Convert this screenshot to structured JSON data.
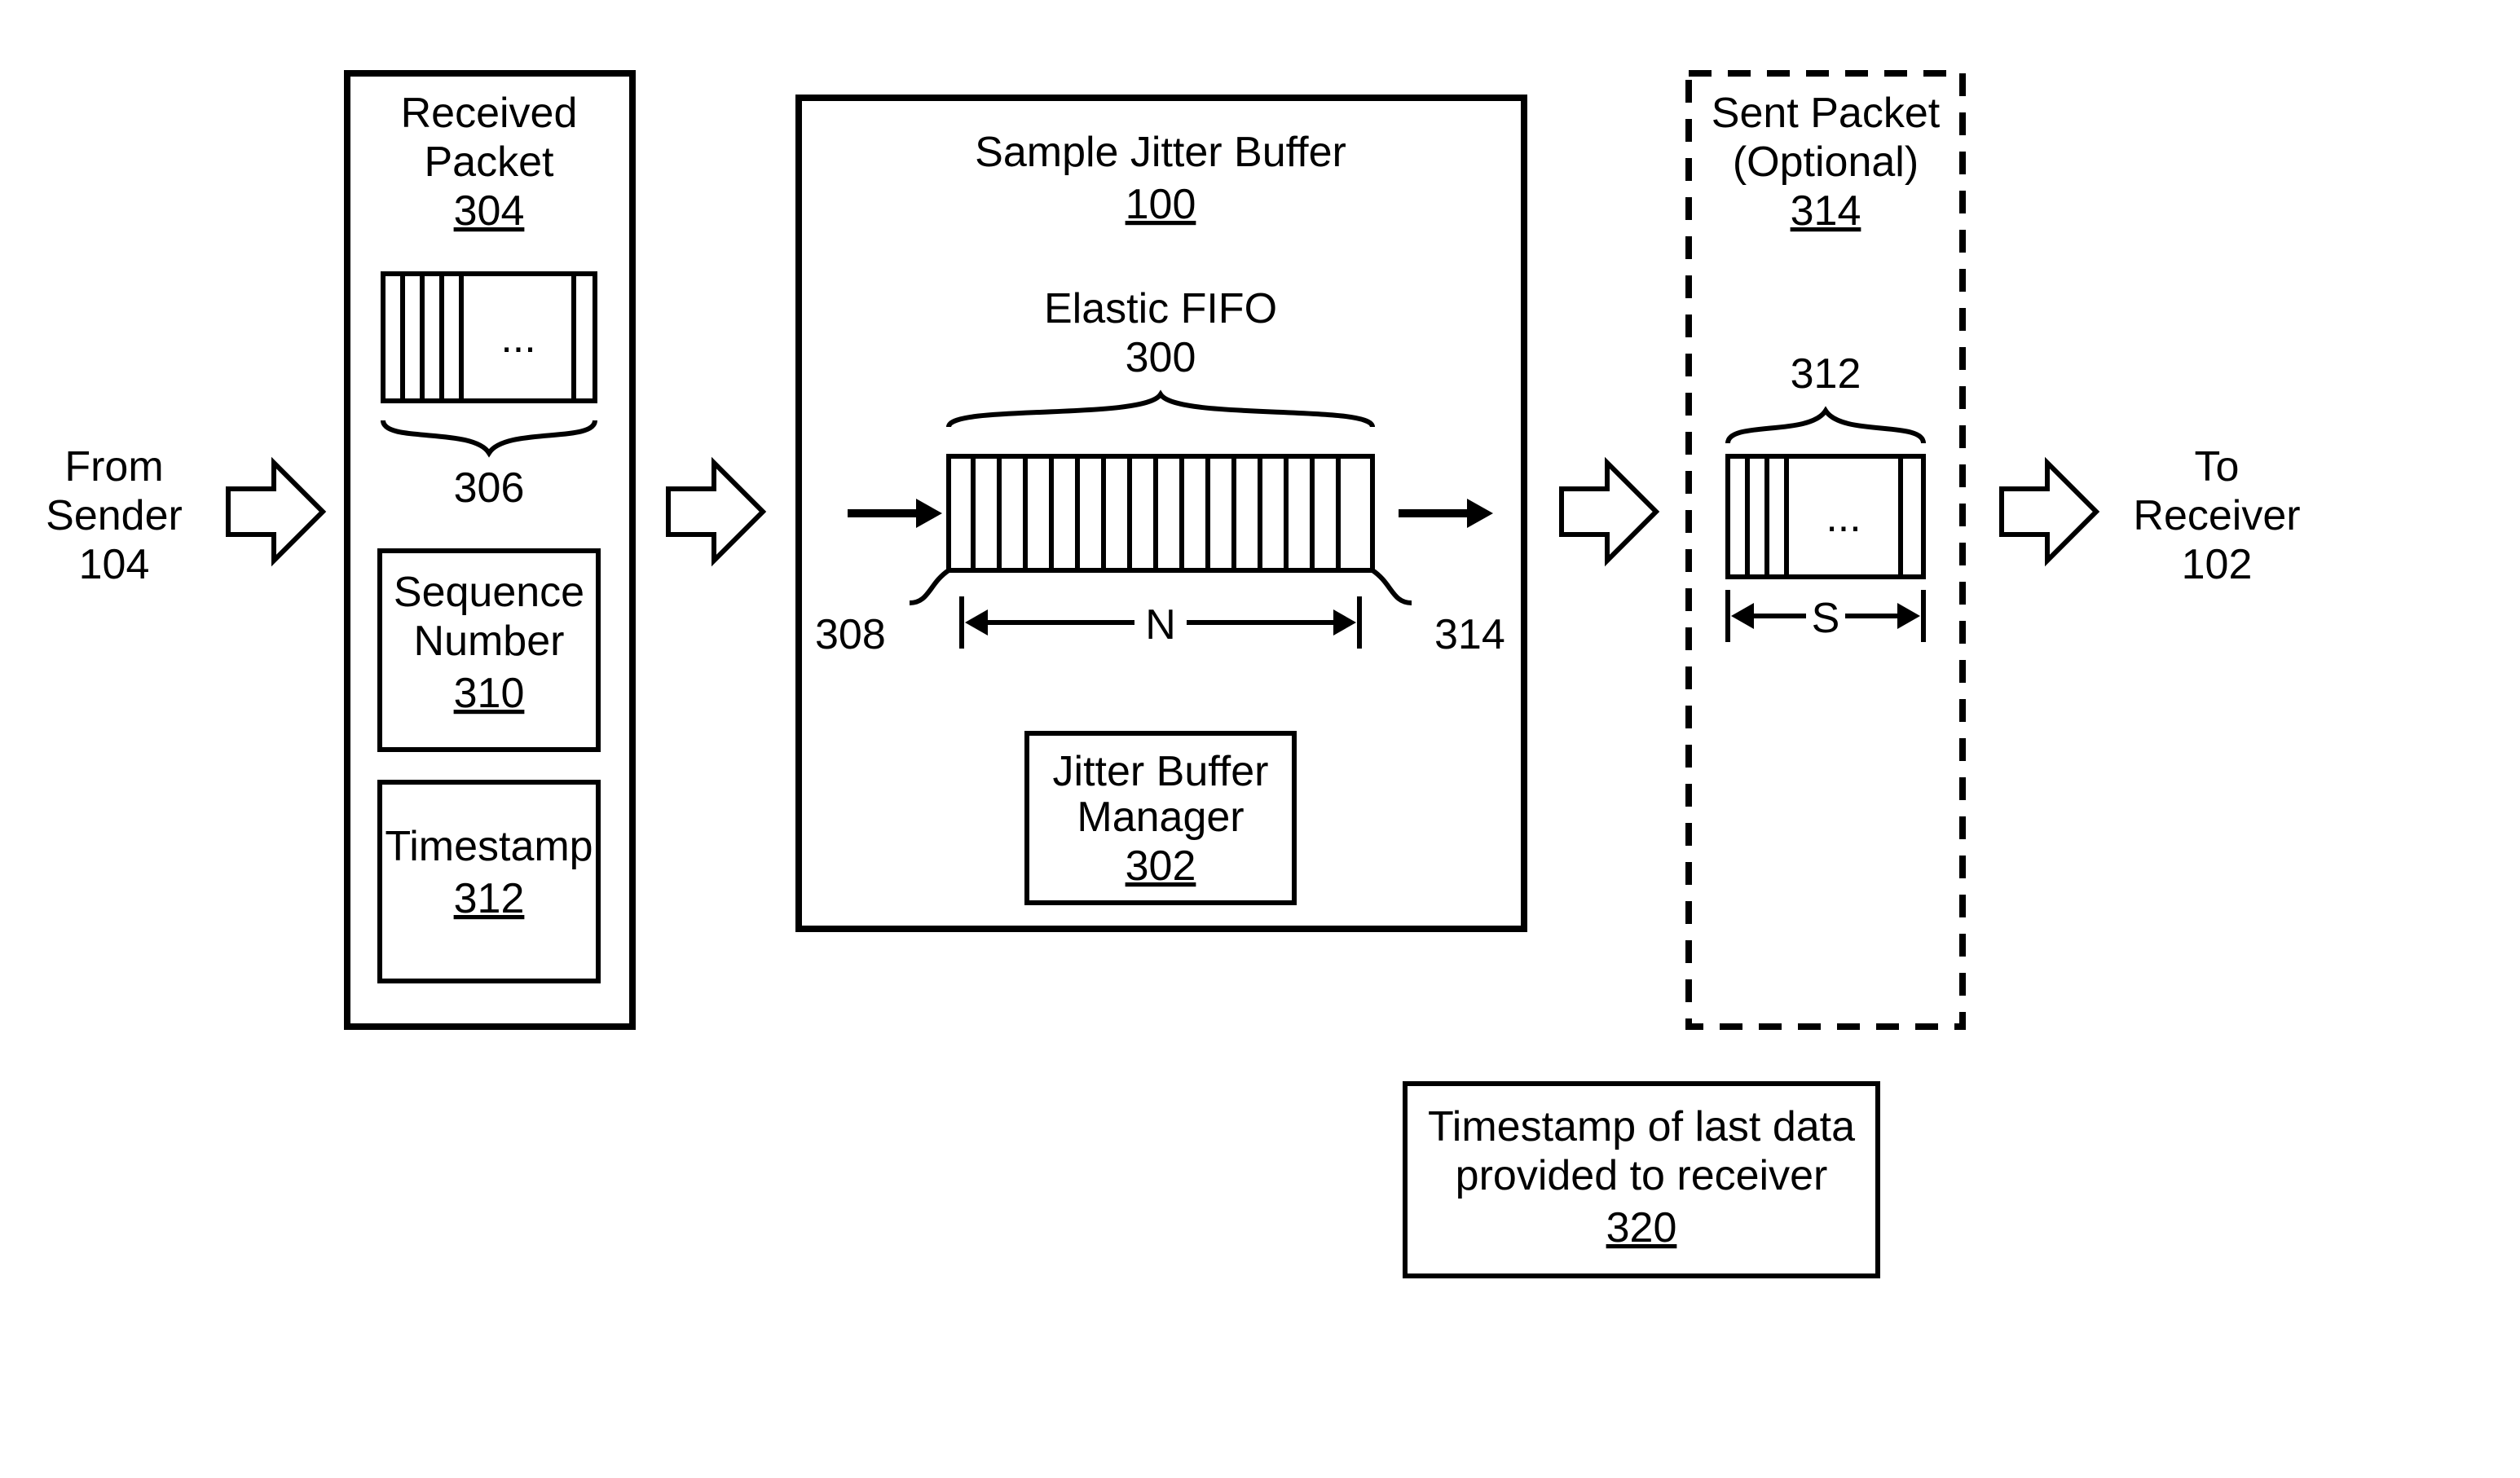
{
  "from_sender": {
    "line1": "From",
    "line2": "Sender",
    "ref": "104"
  },
  "to_receiver": {
    "line1": "To",
    "line2": "Receiver",
    "ref": "102"
  },
  "received_packet": {
    "title_line1": "Received",
    "title_line2": "Packet",
    "ref": "304",
    "samples_ref": "306",
    "sequence": {
      "line1": "Sequence",
      "line2": "Number",
      "ref": "310"
    },
    "timestamp": {
      "line1": "Timestamp",
      "ref": "312"
    }
  },
  "jitter_buffer": {
    "title": "Sample Jitter Buffer",
    "ref": "100",
    "fifo_title": "Elastic FIFO",
    "fifo_ref": "300",
    "left_ref": "308",
    "right_ref": "314",
    "width_label": "N",
    "manager": {
      "line1": "Jitter Buffer",
      "line2": "Manager",
      "ref": "302"
    }
  },
  "sent_packet": {
    "title_line1": "Sent Packet",
    "title_line2": "(Optional)",
    "ref": "314",
    "samples_ref": "312",
    "width_label": "S"
  },
  "timestamp_box": {
    "line1": "Timestamp of last data",
    "line2": "provided to receiver",
    "ref": "320"
  },
  "ellipsis": "...",
  "chart_data": {
    "type": "diagram",
    "title": "Sample Jitter Buffer block diagram",
    "nodes": [
      {
        "id": "sender",
        "label": "From Sender 104"
      },
      {
        "id": "received_packet",
        "label": "Received Packet 304",
        "contains": [
          "samples 306",
          "Sequence Number 310",
          "Timestamp 312"
        ]
      },
      {
        "id": "jitter_buffer",
        "label": "Sample Jitter Buffer 100",
        "contains": [
          "Elastic FIFO 300 (width N, endpoints 308 & 314)",
          "Jitter Buffer Manager 302"
        ]
      },
      {
        "id": "sent_packet",
        "label": "Sent Packet (Optional) 314",
        "contains": [
          "samples 312 (width S)"
        ]
      },
      {
        "id": "receiver",
        "label": "To Receiver 102"
      },
      {
        "id": "ts_last",
        "label": "Timestamp of last data provided to receiver 320"
      }
    ],
    "edges": [
      {
        "from": "sender",
        "to": "received_packet"
      },
      {
        "from": "received_packet",
        "to": "jitter_buffer"
      },
      {
        "from": "jitter_buffer",
        "to": "sent_packet"
      },
      {
        "from": "sent_packet",
        "to": "receiver"
      }
    ]
  }
}
